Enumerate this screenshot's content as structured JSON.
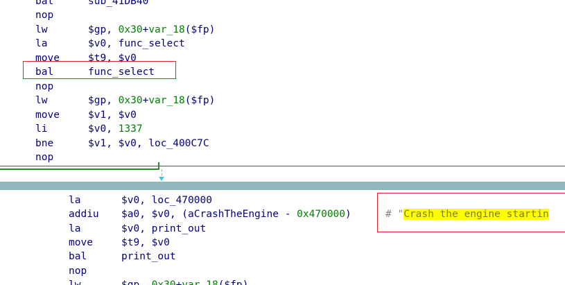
{
  "top_block": {
    "lines": [
      {
        "mnemonic": "bal",
        "operand": "sub_41DB40"
      },
      {
        "mnemonic": "nop",
        "operand": ""
      },
      {
        "mnemonic": "lw",
        "operand": "$gp, 0x30+var_18($fp)"
      },
      {
        "mnemonic": "la",
        "operand": "$v0, func_select"
      },
      {
        "mnemonic": "move",
        "operand": "$t9, $v0"
      },
      {
        "mnemonic": "bal",
        "operand": "func_select"
      },
      {
        "mnemonic": "nop",
        "operand": ""
      },
      {
        "mnemonic": "lw",
        "operand": "$gp, 0x30+var_18($fp)"
      },
      {
        "mnemonic": "move",
        "operand": "$v1, $v0"
      },
      {
        "mnemonic": "li",
        "operand": "$v0, 1337"
      },
      {
        "mnemonic": "bne",
        "operand": "$v1, $v0, loc_400C7C"
      },
      {
        "mnemonic": "nop",
        "operand": ""
      }
    ]
  },
  "bottom_block": {
    "lines": [
      {
        "mnemonic": "la",
        "operand": "$v0, loc_470000"
      },
      {
        "mnemonic": "addiu",
        "operand": "$a0, $v0, (aCrashTheEngine - 0x470000)"
      },
      {
        "mnemonic": "la",
        "operand": "$v0, print_out"
      },
      {
        "mnemonic": "move",
        "operand": "$t9, $v0"
      },
      {
        "mnemonic": "bal",
        "operand": "print_out"
      },
      {
        "mnemonic": "nop",
        "operand": ""
      },
      {
        "mnemonic": "lw",
        "operand": "$gp, 0x30+var_18($fp)"
      }
    ],
    "comment_prefix": "# \"",
    "comment_string": "Crash the engine startin"
  },
  "colors": {
    "mnemonic": "#000080",
    "number": "#008000",
    "highlight_box": "#e0262b",
    "string_background": "#ffff00",
    "divider": "#8fb7bd"
  }
}
